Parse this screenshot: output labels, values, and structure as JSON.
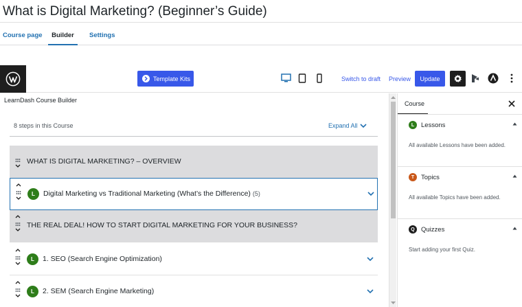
{
  "page": {
    "title": "What is Digital Marketing? (Beginner’s Guide)"
  },
  "tabs": [
    {
      "label": "Course page"
    },
    {
      "label": "Builder"
    },
    {
      "label": "Settings"
    }
  ],
  "toolbar": {
    "template_kits_label": "Template Kits",
    "switch_draft_label": "Switch to draft",
    "preview_label": "Preview",
    "update_label": "Update",
    "icons": [
      "wordpress-icon",
      "desktop-icon",
      "tablet-icon",
      "mobile-icon",
      "gear-icon",
      "astra-icon",
      "more-icon"
    ]
  },
  "builder": {
    "title": "LearnDash Course Builder",
    "steps_count": "8 steps in this Course",
    "expand_all": "Expand All",
    "rows": [
      {
        "type": "section",
        "label": "WHAT IS DIGITAL MARKETING? – OVERVIEW"
      },
      {
        "type": "lesson",
        "badge": "L",
        "label": "Digital Marketing vs Traditional Marketing (What’s the Difference)",
        "count": "(5)",
        "selected": true
      },
      {
        "type": "section",
        "label": "THE REAL DEAL! HOW TO START DIGITAL MARKETING FOR YOUR BUSINESS?"
      },
      {
        "type": "lesson",
        "badge": "L",
        "label": "1. SEO (Search Engine Optimization)"
      },
      {
        "type": "lesson",
        "badge": "L",
        "label": "2. SEM (Search Engine Marketing)"
      }
    ]
  },
  "sidebar": {
    "tab_label": "Course",
    "panels": [
      {
        "badge": "L",
        "badge_color": "#2e7d1a",
        "title": "Lessons",
        "note": "All available Lessons have been added."
      },
      {
        "badge": "T",
        "badge_color": "#c9581a",
        "title": "Topics",
        "note": "All available Topics have been added."
      },
      {
        "badge": "Q",
        "badge_color": "#1e1e1e",
        "title": "Quizzes",
        "note": "Start adding your first Quiz."
      }
    ]
  },
  "colors": {
    "accent": "#3858e9",
    "link": "#2271b1",
    "lesson_badge": "#2e7d1a",
    "topic_badge": "#c9581a"
  }
}
